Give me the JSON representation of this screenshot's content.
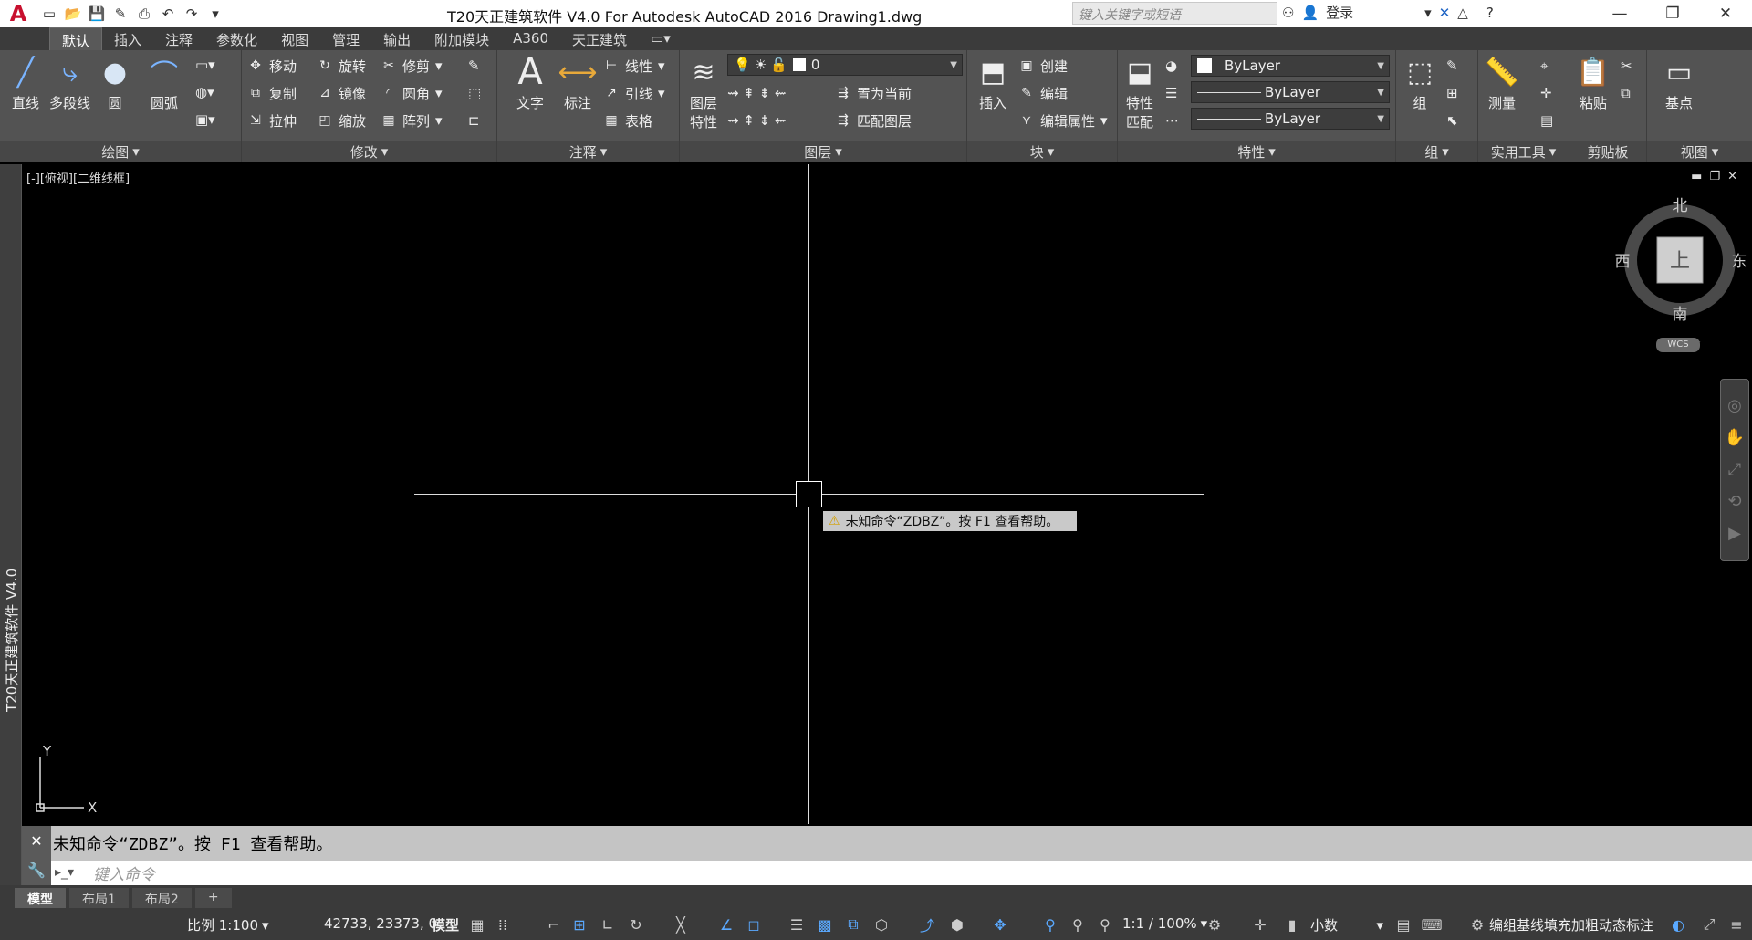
{
  "window": {
    "title": "T20天正建筑软件 V4.0 For Autodesk AutoCAD 2016    Drawing1.dwg",
    "search_placeholder": "键入关键字或短语",
    "login_label": "登录"
  },
  "tabs": [
    "默认",
    "插入",
    "注释",
    "参数化",
    "视图",
    "管理",
    "输出",
    "附加模块",
    "A360",
    "天正建筑"
  ],
  "ribbon": {
    "draw": {
      "title": "绘图",
      "line": "直线",
      "polyline": "多段线",
      "circle": "圆",
      "arc": "圆弧"
    },
    "modify": {
      "title": "修改",
      "move": "移动",
      "rotate": "旋转",
      "trim": "修剪",
      "copy": "复制",
      "mirror": "镜像",
      "fillet": "圆角",
      "stretch": "拉伸",
      "scale": "缩放",
      "array": "阵列"
    },
    "annotation": {
      "title": "注释",
      "text": "文字",
      "dimension": "标注",
      "linear": "线性",
      "leader": "引线",
      "table": "表格"
    },
    "layers": {
      "title": "图层",
      "layer_props_1": "图层",
      "layer_props_2": "特性",
      "current_layer": "0",
      "make_current": "置为当前",
      "match_layer": "匹配图层"
    },
    "block": {
      "title": "块",
      "insert": "插入",
      "create": "创建",
      "edit": "编辑",
      "edit_attr": "编辑属性"
    },
    "properties": {
      "title": "特性",
      "match_1": "特性",
      "match_2": "匹配",
      "color": "ByLayer",
      "linetype": "ByLayer",
      "lineweight": "ByLayer"
    },
    "groups": {
      "title": "组",
      "group": "组"
    },
    "utilities": {
      "title": "实用工具",
      "measure": "测量"
    },
    "clipboard": {
      "title": "剪贴板",
      "paste": "粘贴"
    },
    "view": {
      "title": "视图",
      "base": "基点"
    }
  },
  "viewport": {
    "label": "[-][俯视][二维线框]",
    "tooltip": "未知命令“ZDBZ”。按 F1 查看帮助。",
    "side_ribbon": "T20天正建筑软件 V4.0",
    "ucs_x": "X",
    "ucs_y": "Y"
  },
  "viewcube": {
    "north": "北",
    "south": "南",
    "east": "东",
    "west": "西",
    "top": "上",
    "wcs": "WCS"
  },
  "command": {
    "history": "未知命令“ZDBZ”。按 F1 查看帮助。",
    "placeholder": "键入命令"
  },
  "layout_tabs": [
    "模型",
    "布局1",
    "布局2"
  ],
  "statusbar": {
    "scale": "比例 1:100",
    "coords": "42733, 23373, 0",
    "model": "模型",
    "annotation_scale": "1:1 / 100%",
    "units": "小数",
    "tz_msg": "编组基线填充加粗动态标注"
  }
}
